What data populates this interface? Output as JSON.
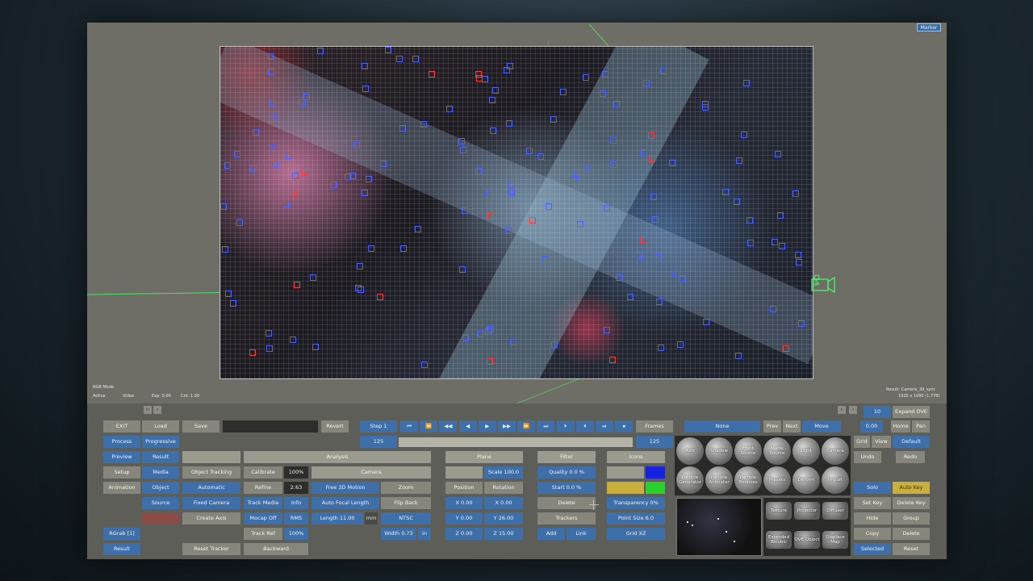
{
  "app": {
    "marker_label": "Marker",
    "rgb_mode": "RGB Mode",
    "active": "Active",
    "video": "Video",
    "exp": "Exp: 0.00",
    "cnt": "Cnt: 1.00",
    "result_name": "Result: Camera_3d_sync",
    "result_res": "1920 x 1080 (1.778)"
  },
  "left_column": {
    "exit": "EXIT",
    "process": "Process",
    "preview": "Preview",
    "setup": "Setup",
    "animation": "Animation",
    "rgrab": "RGrab [1]",
    "result": "Result"
  },
  "col2": {
    "load": "Load",
    "progressive": "Progressive",
    "result": "Result",
    "media": "Media",
    "object": "Object",
    "source": "Source"
  },
  "col3": {
    "save": "Save",
    "object_tracking": "Object Tracking",
    "automatic": "Automatic",
    "fixed_camera": "Fixed Camera",
    "create_axis": "Create Axis",
    "reset_tracker": "Reset Tracker"
  },
  "col4": {
    "revert": "Revert",
    "calibrate": "Calibrate",
    "calibrate_val": "100%",
    "refine": "Refine",
    "refine_val": "2.63",
    "track_media": "Track Media",
    "info": "Info",
    "mocap_off": "Mocap Off",
    "mocap_val": "RMS",
    "track_ref": "Track Ref",
    "track_ref_val": "100%",
    "backward": "Backward"
  },
  "analysis": {
    "header": "Analysis",
    "camera": "Camera",
    "free_3d_motion": "Free 3D Motion",
    "zoom": "Zoom",
    "auto_focal_length": "Auto Focal Length",
    "flip_back": "Flip Back",
    "length_field": "Length 11.00",
    "mm": "mm",
    "ntsc": "NTSC",
    "width": "Width 0.73",
    "in": "in"
  },
  "transport": {
    "step": "Step 1",
    "frames": "Frames",
    "frame_start": "125",
    "frame_end": "125"
  },
  "plane": {
    "header": "Plane",
    "scale": "Scale 100.0",
    "position": "Position",
    "rotation": "Rotation",
    "x_val": "X 0.00",
    "x_rot": "X 0.00",
    "y_val": "Y 0.00",
    "y_rot": "Y 26.00",
    "z_val": "Z 0.00",
    "z_rot": "Z 15.00"
  },
  "filter": {
    "header": "Filter",
    "quality": "Quality 0.0 %",
    "start": "Start 0.0 %",
    "delete": "Delete",
    "trackers": "Trackers",
    "add": "Add",
    "link": "Link"
  },
  "icons": {
    "header": "Icons",
    "transparency": "Transparency 0%",
    "point_size": "Point Size 6.0",
    "grid": "Grid XZ"
  },
  "right_top": {
    "name_field": "None",
    "prev": "Prev",
    "next": "Next",
    "move": "Move",
    "value": "10",
    "expand": "Expand OVE",
    "zoom_val": "0.00",
    "home": "Home",
    "pan": "Pan",
    "grid": "Grid",
    "view": "View",
    "default": "Default",
    "undo": "Undo",
    "redo": "Redo"
  },
  "spheres": [
    "Axis",
    "Shadow",
    "Front Source",
    "Matte Source",
    "Light",
    "Camera",
    "Particle Generator",
    "Particle Animator",
    "Particle Bounces",
    "Presets",
    "Deform",
    "Import"
  ],
  "tools": [
    "Texture",
    "Projector",
    "Diffuser",
    "Extended Bicubic",
    "OVE Object",
    "Displace Map"
  ],
  "right_bottom": {
    "solo": "Solo",
    "auto_key": "Auto Key",
    "set_key": "Set Key",
    "delete_key": "Delete Key",
    "hide": "Hide",
    "group": "Group",
    "copy": "Copy",
    "delete": "Delete",
    "selected": "Selected",
    "reset": "Reset"
  },
  "colors": {
    "accent_blue": "#3f6fa8",
    "panel_grey": "#6e6e66",
    "track_blue": "#4d63ff",
    "scene_green": "#48ff6a"
  }
}
